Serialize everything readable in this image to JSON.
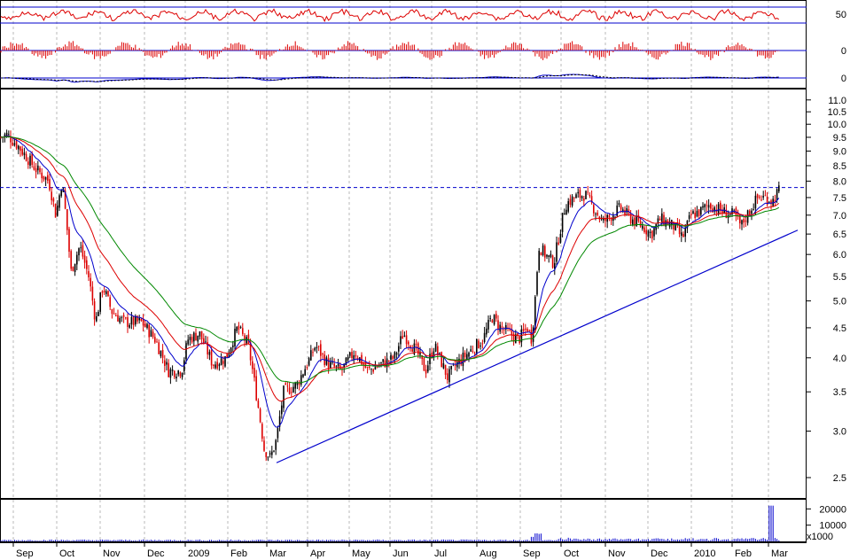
{
  "chart_data": {
    "type": "candlestick",
    "title": "",
    "x_labels": [
      "Sep",
      "Oct",
      "Nov",
      "Dec",
      "2009",
      "Feb",
      "Mar",
      "Apr",
      "May",
      "Jun",
      "Jul",
      "Aug",
      "Sep",
      "Oct",
      "Nov",
      "Dec",
      "2010",
      "Feb",
      "Mar"
    ],
    "price_axis": {
      "scale": "log",
      "ylim": [
        2.3,
        11.5
      ],
      "ticks": [
        "2.5",
        "3.0",
        "3.5",
        "4.0",
        "4.5",
        "5.0",
        "5.5",
        "6.0",
        "6.5",
        "7.0",
        "7.5",
        "8.0",
        "8.5",
        "9.0",
        "9.5",
        "10.0",
        "10.5",
        "11.0"
      ]
    },
    "resistance_level": 7.8,
    "trendline": {
      "start": [
        "Mar",
        2.65
      ],
      "end": [
        "Mar 2010",
        6.6
      ]
    },
    "price_series": [
      {
        "label": "Sep",
        "close": 9.5
      },
      {
        "label": "Oct",
        "close": 7.0
      },
      {
        "label": "Nov",
        "close": 5.2
      },
      {
        "label": "Dec",
        "close": 4.0
      },
      {
        "label": "2009",
        "close": 4.2
      },
      {
        "label": "Feb",
        "close": 4.2
      },
      {
        "label": "Mar",
        "close": 2.9
      },
      {
        "label": "Apr",
        "close": 4.0
      },
      {
        "label": "May",
        "close": 3.9
      },
      {
        "label": "Jun",
        "close": 4.1
      },
      {
        "label": "Jul",
        "close": 3.8
      },
      {
        "label": "Aug",
        "close": 4.5
      },
      {
        "label": "Sep",
        "close": 4.3
      },
      {
        "label": "Oct",
        "close": 7.4
      },
      {
        "label": "Nov",
        "close": 6.9
      },
      {
        "label": "Dec",
        "close": 6.7
      },
      {
        "label": "2010",
        "close": 7.2
      },
      {
        "label": "Feb",
        "close": 7.0
      },
      {
        "label": "Mar",
        "close": 7.7
      }
    ],
    "moving_averages": [
      {
        "name": "",
        "color": "#0000cc"
      },
      {
        "name": "",
        "color": "#dd0000"
      },
      {
        "name": "",
        "color": "#008800"
      }
    ],
    "indicator_panels": [
      {
        "ticks": [
          "50"
        ]
      },
      {
        "ticks": [
          "0"
        ]
      },
      {
        "ticks": [
          "0"
        ]
      }
    ],
    "volume_axis": {
      "ticks": [
        "20000",
        "10000"
      ],
      "unit": "x1000",
      "spike": [
        "Mar 2010",
        22000
      ]
    }
  }
}
